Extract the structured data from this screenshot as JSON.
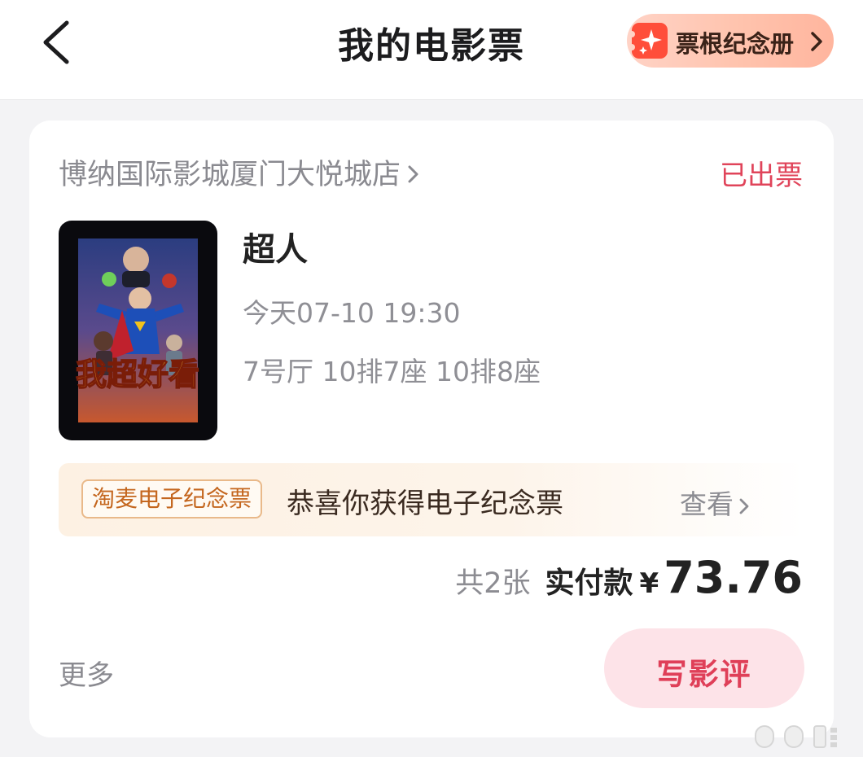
{
  "header": {
    "title": "我的电影票",
    "back_icon": "chevron-left-icon",
    "stub_button_label": "票根纪念册"
  },
  "order": {
    "cinema": "博纳国际影城厦门大悦城店",
    "status": "已出票",
    "movie_title": "超人",
    "poster_caption": "我超好看",
    "showtime": "今天07-10 19:30",
    "seats": "7号厅 10排7座 10排8座",
    "memo": {
      "badge": "淘麦电子纪念票",
      "text": "恭喜你获得电子纪念票",
      "view_label": "查看"
    },
    "count": "共2张",
    "paid_label": "实付款",
    "currency": "¥",
    "amount": "73.76",
    "more_label": "更多",
    "review_button": "写影评"
  },
  "colors": {
    "accent": "#e0445a",
    "background": "#f3f3f5",
    "card": "#ffffff",
    "review_button_bg": "#fde3e8"
  }
}
